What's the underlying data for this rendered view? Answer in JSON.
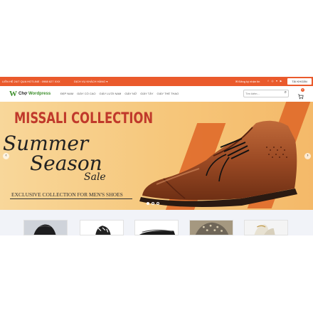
{
  "topbar": {
    "hotline": "LIÊN HỆ 24/7 QUA HOTLINE : 0988 627 XXX",
    "service": "DỊCH VỤ KHÁCH HÀNG ▾",
    "login": "Đăng ký nhận tin",
    "account": "TÀI KHOẢN",
    "socials": [
      "f",
      "◎",
      "♥",
      "▶"
    ]
  },
  "navbar": {
    "logo_text_prefix": "Chợ",
    "logo_text_brand": "Wordpress",
    "menu": [
      "ĐẸP NAM",
      "GIÀY CỔ CAO",
      "GIÀY LƯỜI NAM",
      "GIÀY NỮ",
      "GIÀY TÂY",
      "GIÀY THỂ THAO"
    ],
    "search_placeholder": "Tìm kiếm...",
    "cart_count": "0"
  },
  "banner": {
    "title": "MISSALI COLLECTION",
    "script_line1": "Summer",
    "script_line2": "Season",
    "script_line3": "Sale",
    "tagline": "EXCLUSIVE COLLECTION FOR MEN'S SHOES",
    "slide_count": 3,
    "active_slide": 1
  },
  "colors": {
    "accent": "#ea5a2c",
    "brand_green": "#3b8e2a",
    "banner_title": "#c0392b",
    "banner_bg": "#f6c87e",
    "shoe_leather": "#9b4a24"
  },
  "products": [
    {
      "icon": "black-sneaker-image"
    },
    {
      "icon": "black-white-sneaker-image"
    },
    {
      "icon": "black-sandal-image"
    },
    {
      "icon": "patterned-sneaker-image"
    },
    {
      "icon": "white-sneaker-image"
    }
  ]
}
